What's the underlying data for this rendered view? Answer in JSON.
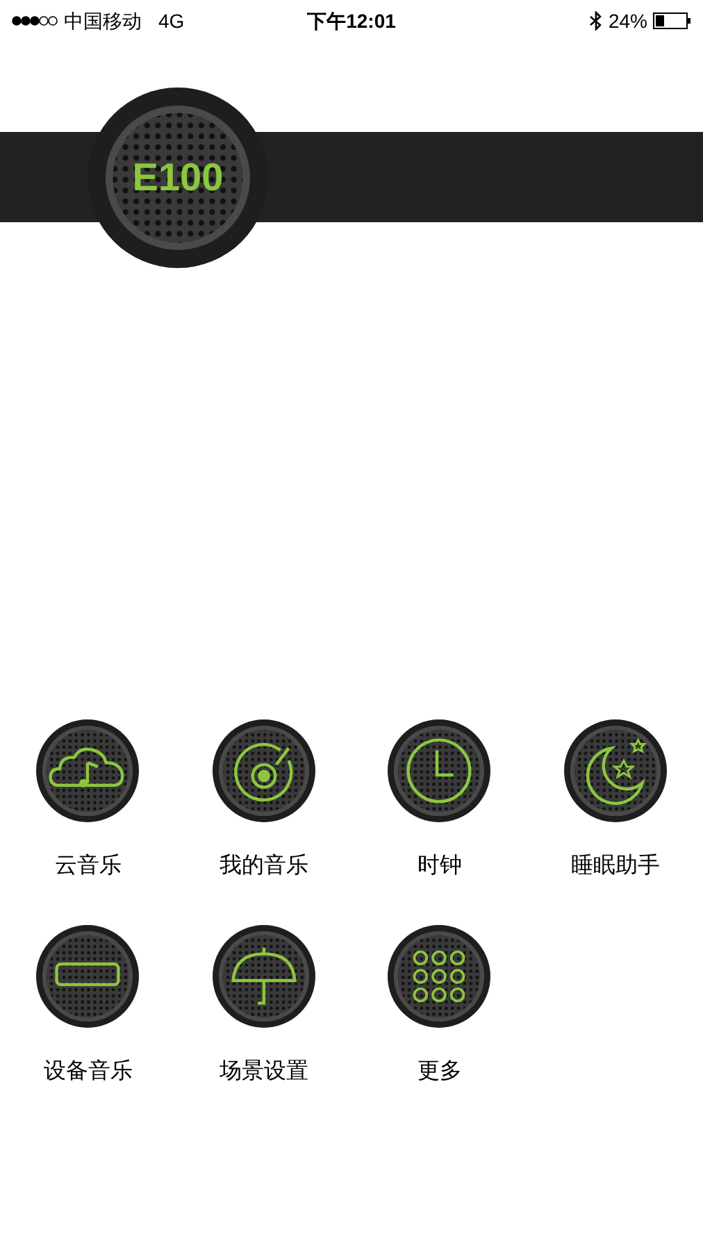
{
  "status_bar": {
    "carrier": "中国移动",
    "network": "4G",
    "time": "下午12:01",
    "battery": "24%"
  },
  "header": {
    "device": "E100"
  },
  "menu": [
    {
      "label": "云音乐",
      "kind": "cloud"
    },
    {
      "label": "我的音乐",
      "kind": "disc"
    },
    {
      "label": "时钟",
      "kind": "clock"
    },
    {
      "label": "睡眠助手",
      "kind": "moon"
    },
    {
      "label": "设备音乐",
      "kind": "device"
    },
    {
      "label": "场景设置",
      "kind": "umbrella"
    },
    {
      "label": "更多",
      "kind": "more"
    }
  ]
}
